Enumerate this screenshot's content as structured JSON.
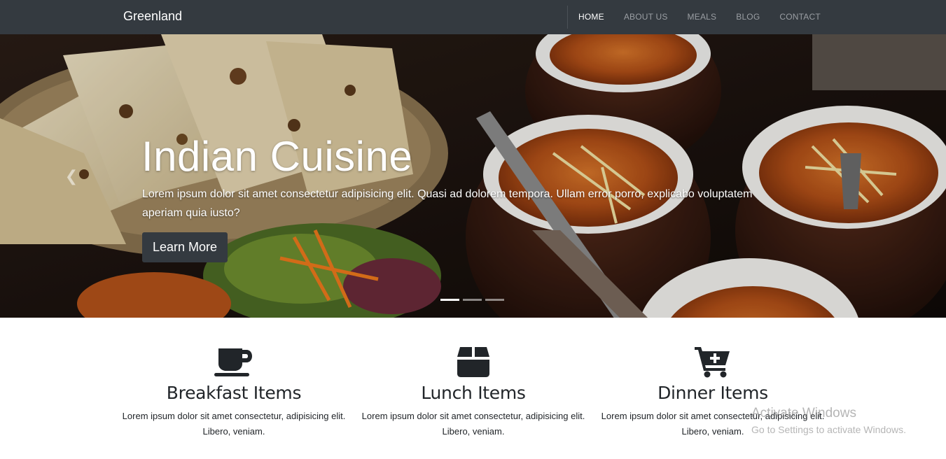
{
  "navbar": {
    "brand": "Greenland",
    "links": [
      {
        "label": "HOME",
        "active": true
      },
      {
        "label": "ABOUT US",
        "active": false
      },
      {
        "label": "MEALS",
        "active": false
      },
      {
        "label": "BLOG",
        "active": false
      },
      {
        "label": "CONTACT",
        "active": false
      }
    ]
  },
  "hero": {
    "title": "Indian Cuisine",
    "text": "Lorem ipsum dolor sit amet consectetur adipisicing elit. Quasi ad dolorem tempora. Ullam error porro, explicabo voluptatem aperiam quia iusto?",
    "button_label": "Learn More",
    "prev_icon": "chevron-left-icon",
    "slides_total": 3,
    "active_slide": 1
  },
  "features": [
    {
      "icon": "coffee-cup-icon",
      "title": "Breakfast Items",
      "text": "Lorem ipsum dolor sit amet consectetur, adipisicing elit. Libero, veniam."
    },
    {
      "icon": "box-icon",
      "title": "Lunch Items",
      "text": "Lorem ipsum dolor sit amet consectetur, adipisicing elit. Libero, veniam."
    },
    {
      "icon": "cart-plus-icon",
      "title": "Dinner Items",
      "text": "Lorem ipsum dolor sit amet consectetur, adipisicing elit. Libero, veniam."
    }
  ],
  "watermark": {
    "line1": "Activate Windows",
    "line2": "Go to Settings to activate Windows."
  },
  "colors": {
    "navbar_bg": "#343a40",
    "button_bg": "#343a40",
    "text": "#212529"
  }
}
